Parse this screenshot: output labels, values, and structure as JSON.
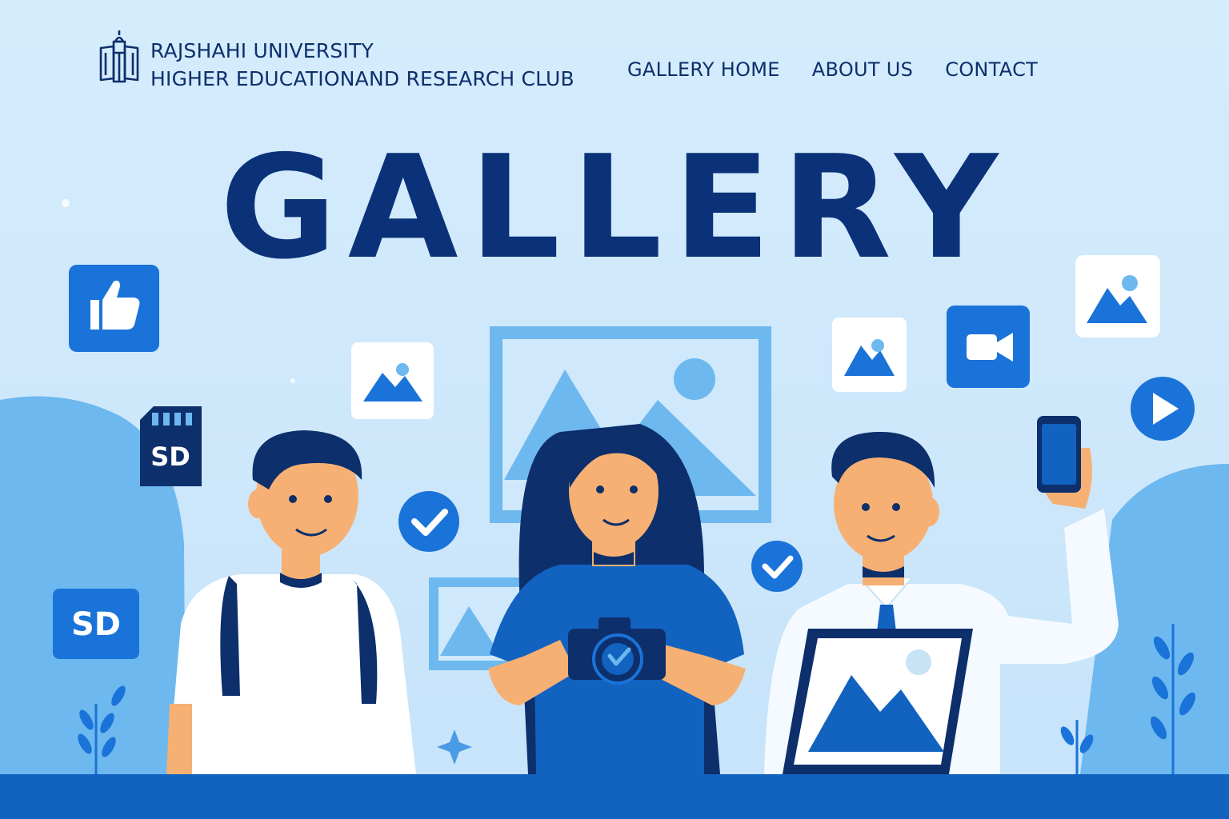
{
  "header": {
    "brand_line1": "RAJSHAHI UNIVERSITY",
    "brand_line2": "HIGHER EDUCATIONAND RESEARCH CLUB",
    "logo_icon": "university-building-icon",
    "nav": [
      {
        "label": "GALLERY HOME"
      },
      {
        "label": "ABOUT US"
      },
      {
        "label": "CONTACT"
      }
    ]
  },
  "hero": {
    "title": "GALLERY"
  },
  "illustration": {
    "sd_card_label": "SD",
    "sd_tile_label": "SD",
    "icons": [
      "thumbs-up-icon",
      "sd-card-icon",
      "image-icon",
      "video-camera-icon",
      "play-icon",
      "check-circle-icon"
    ]
  },
  "colors": {
    "background": "#cfe8fb",
    "primary_dark": "#0b3178",
    "primary": "#1262bf",
    "accent": "#1a73d9",
    "light_blue": "#6cb8ef"
  }
}
